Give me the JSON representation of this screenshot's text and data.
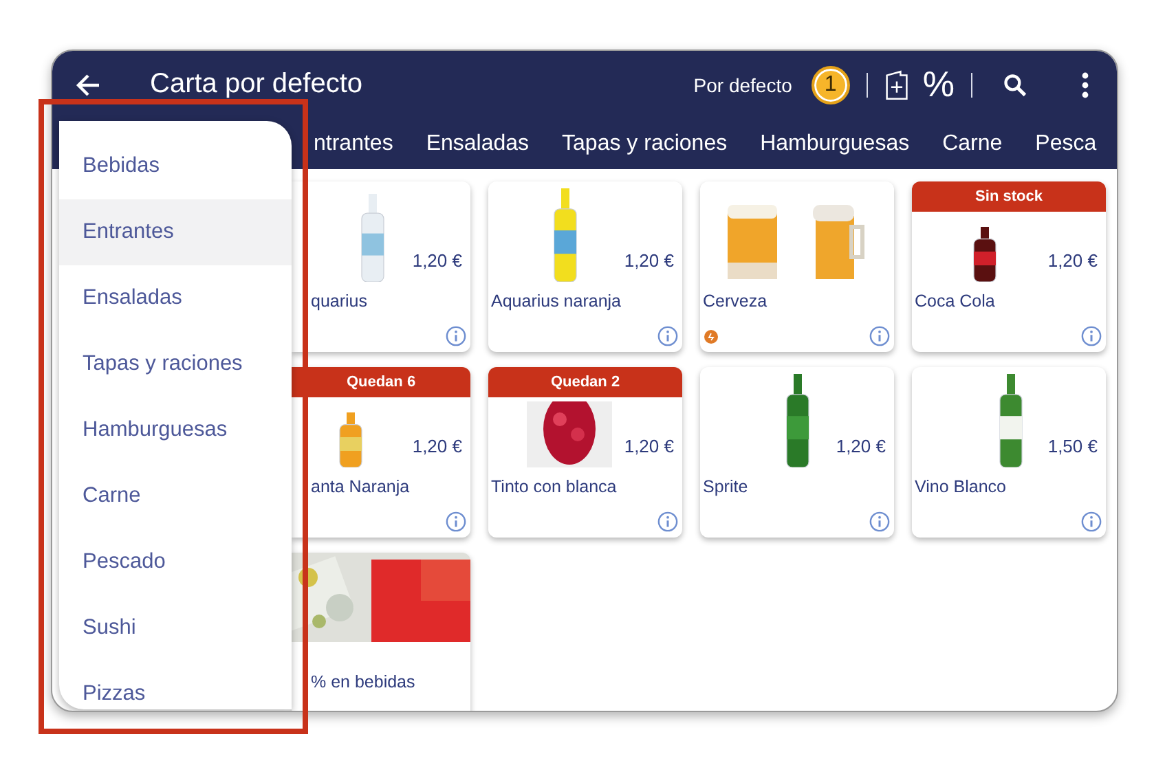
{
  "header": {
    "title": "Carta por defecto",
    "menu_name": "Por defecto",
    "badge": "1",
    "percent": "%"
  },
  "tabs": [
    {
      "label": "ntrantes"
    },
    {
      "label": "Ensaladas"
    },
    {
      "label": "Tapas y raciones"
    },
    {
      "label": "Hamburguesas"
    },
    {
      "label": "Carne"
    },
    {
      "label": "Pesca"
    }
  ],
  "products": [
    {
      "kind": "product",
      "name": "quarius",
      "price": "1,20 €",
      "has_tag": false
    },
    {
      "kind": "product",
      "name": "Aquarius naranja",
      "price": "1,20 €",
      "has_tag": false
    },
    {
      "kind": "product",
      "name": "Cerveza",
      "has_tag": true
    },
    {
      "kind": "product",
      "name": "Coca Cola",
      "price": "1,20 €",
      "banner": "Sin stock",
      "has_tag": false
    },
    {
      "kind": "product",
      "name": "anta Naranja",
      "price": "1,20 €",
      "banner": "Quedan 6",
      "has_tag": false
    },
    {
      "kind": "product",
      "name": "Tinto con blanca",
      "price": "1,20 €",
      "banner": "Quedan 2",
      "has_tag": false
    },
    {
      "kind": "product",
      "name": "Sprite",
      "price": "1,20 €",
      "has_tag": false
    },
    {
      "kind": "product",
      "name": "Vino Blanco",
      "price": "1,50 €",
      "has_tag": false
    },
    {
      "kind": "promo",
      "name": "% en bebidas"
    }
  ],
  "category_menu": [
    {
      "label": "Bebidas",
      "selected": false
    },
    {
      "label": "Entrantes",
      "selected": true
    },
    {
      "label": "Ensaladas",
      "selected": false
    },
    {
      "label": "Tapas y raciones",
      "selected": false
    },
    {
      "label": "Hamburguesas",
      "selected": false
    },
    {
      "label": "Carne",
      "selected": false
    },
    {
      "label": "Pescado",
      "selected": false
    },
    {
      "label": "Sushi",
      "selected": false
    },
    {
      "label": "Pizzas",
      "selected": false
    }
  ]
}
